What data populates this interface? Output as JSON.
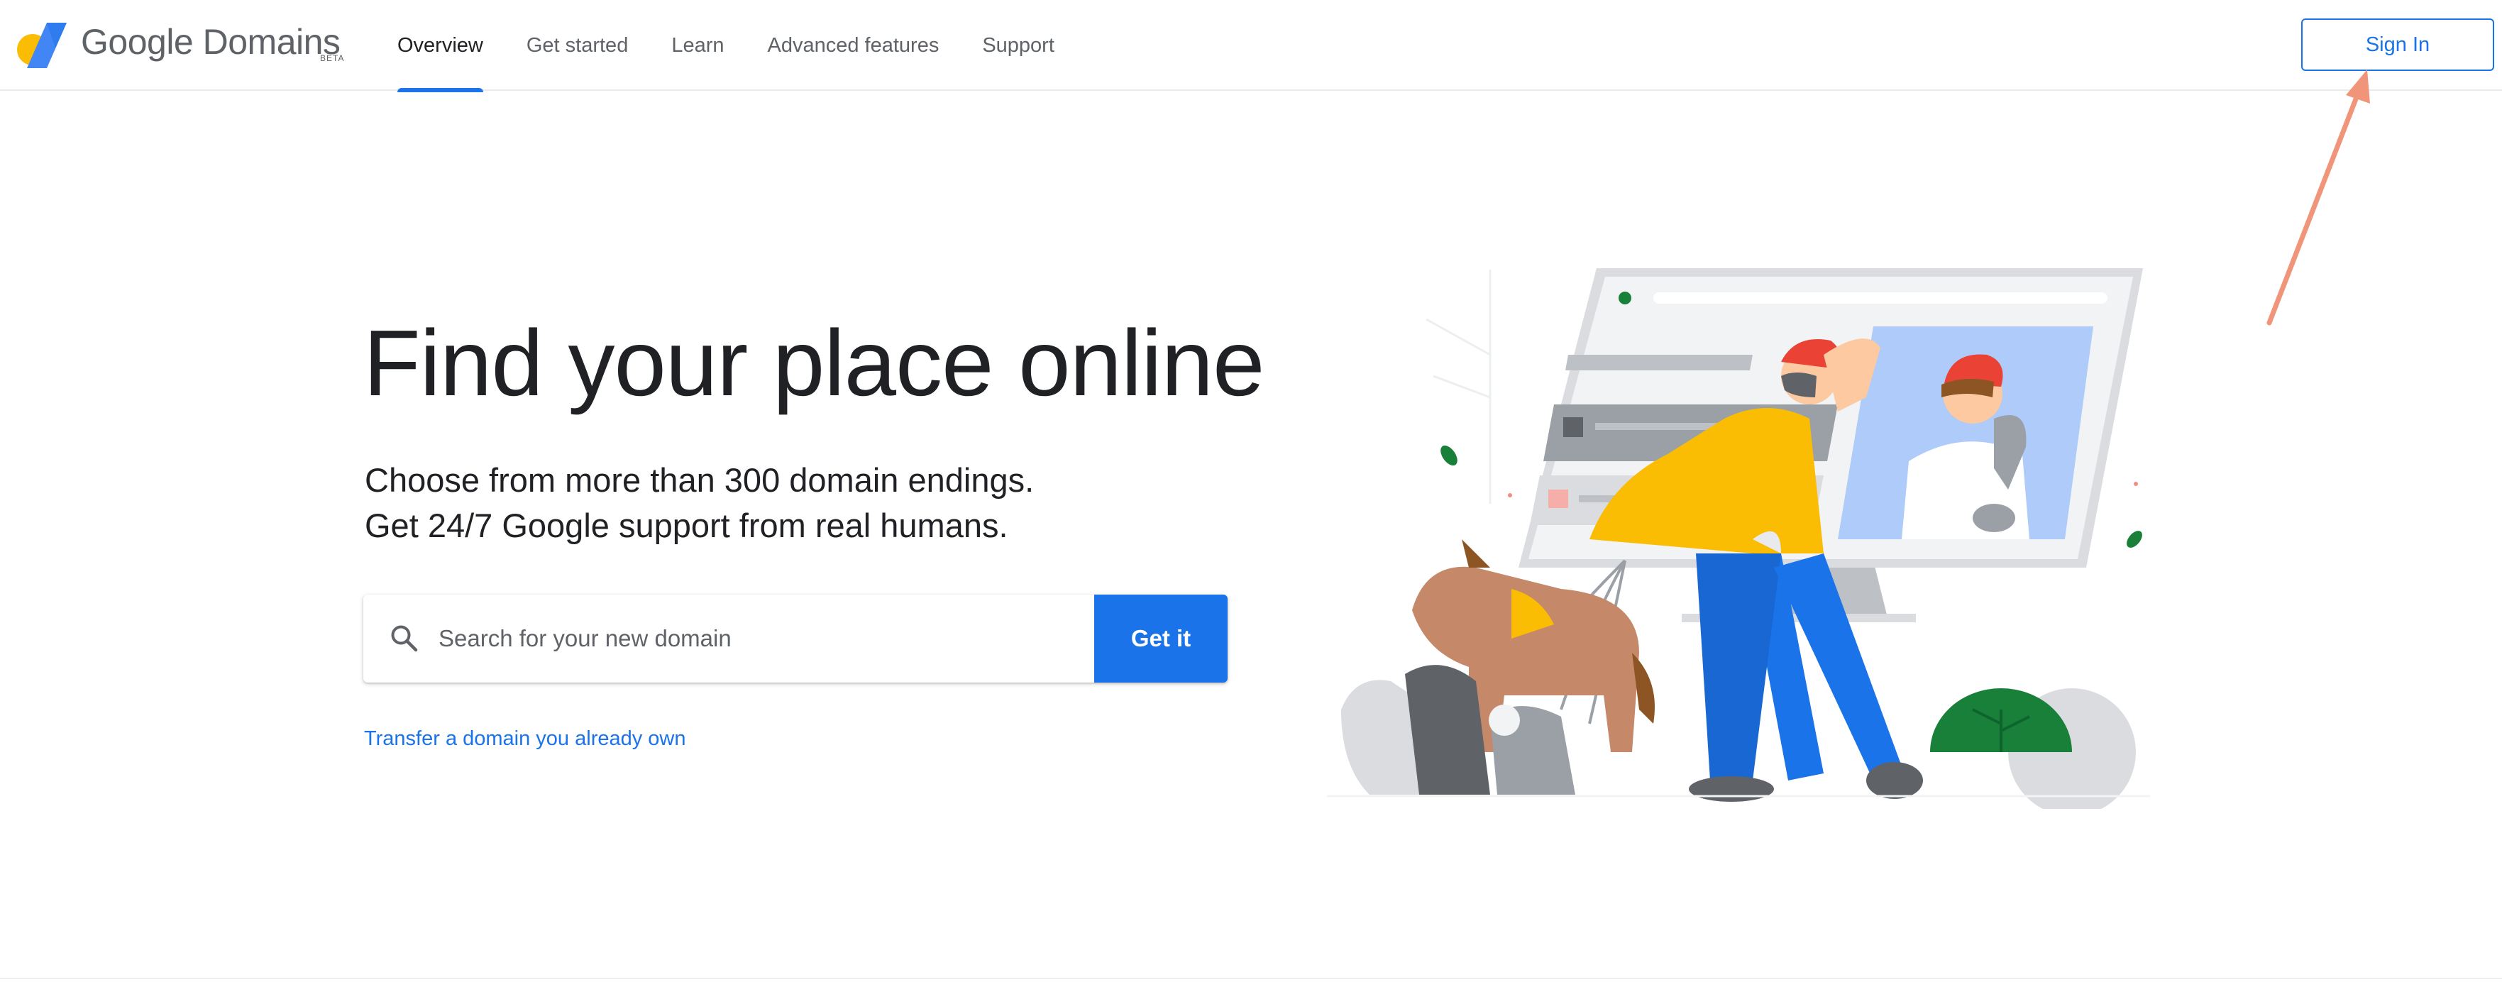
{
  "header": {
    "logo_text": "Google Domains",
    "logo_badge": "BETA",
    "nav": [
      {
        "label": "Overview",
        "active": true
      },
      {
        "label": "Get started",
        "active": false
      },
      {
        "label": "Learn",
        "active": false
      },
      {
        "label": "Advanced features",
        "active": false
      },
      {
        "label": "Support",
        "active": false
      }
    ],
    "sign_in_label": "Sign In"
  },
  "hero": {
    "title": "Find your place online",
    "subtitle_line1": "Choose from more than 300 domain endings.",
    "subtitle_line2": "Get 24/7 Google support from real humans."
  },
  "search": {
    "placeholder": "Search for your new domain",
    "value": "",
    "button_label": "Get it",
    "icon": "search-icon"
  },
  "transfer_link": "Transfer a domain you already own",
  "colors": {
    "accent": "#1a73e8",
    "annotation_arrow": "#f0957a",
    "logo_yellow": "#fbbc04",
    "logo_blue": "#4285f4"
  }
}
